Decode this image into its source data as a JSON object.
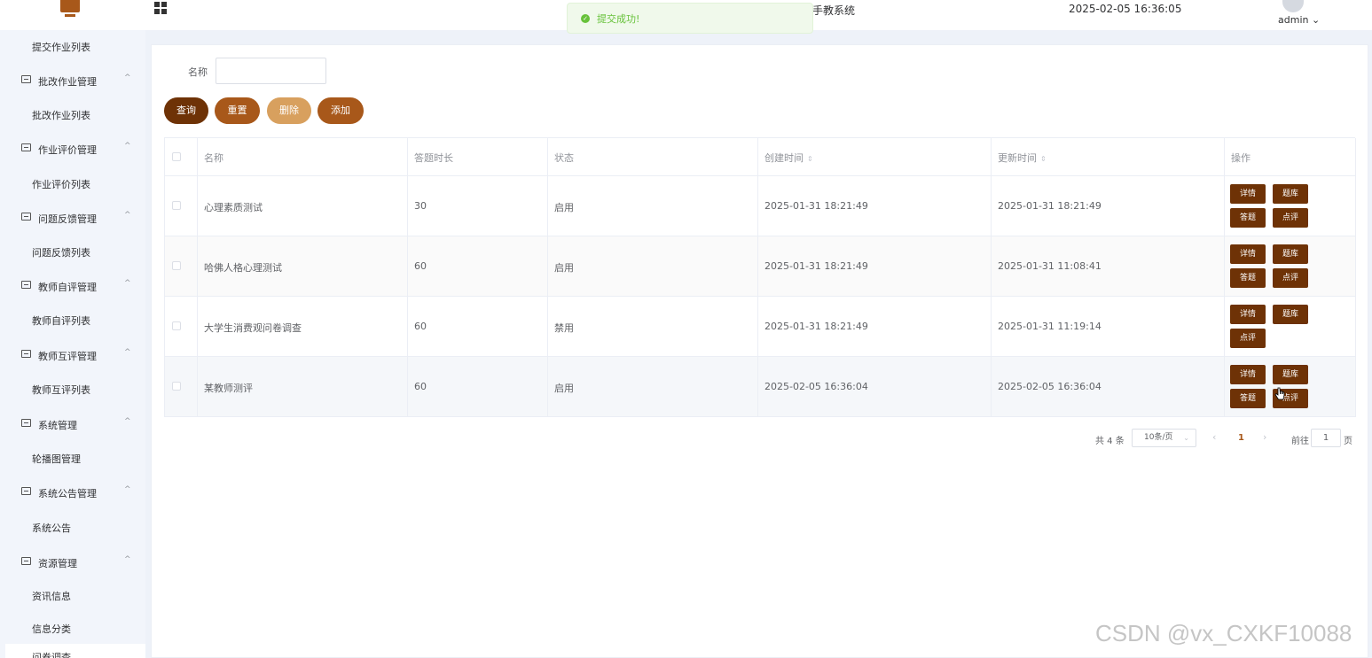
{
  "header": {
    "title": "手教系统",
    "datetime": "2025-02-05 16:36:05",
    "user": "admin",
    "user_caret": "⌄"
  },
  "toast": {
    "message": "提交成功!",
    "icon": "check-circle-icon",
    "color": "#67c23a"
  },
  "sidebar": {
    "items": [
      {
        "label": "提交作业列表",
        "type": "sub"
      },
      {
        "label": "批改作业管理",
        "type": "parent"
      },
      {
        "label": "批改作业列表",
        "type": "sub"
      },
      {
        "label": "作业评价管理",
        "type": "parent"
      },
      {
        "label": "作业评价列表",
        "type": "sub"
      },
      {
        "label": "问题反馈管理",
        "type": "parent"
      },
      {
        "label": "问题反馈列表",
        "type": "sub"
      },
      {
        "label": "教师自评管理",
        "type": "parent"
      },
      {
        "label": "教师自评列表",
        "type": "sub"
      },
      {
        "label": "教师互评管理",
        "type": "parent"
      },
      {
        "label": "教师互评列表",
        "type": "sub"
      },
      {
        "label": "系统管理",
        "type": "parent"
      },
      {
        "label": "轮播图管理",
        "type": "sub"
      },
      {
        "label": "系统公告管理",
        "type": "parent"
      },
      {
        "label": "系统公告",
        "type": "sub"
      },
      {
        "label": "资源管理",
        "type": "parent"
      },
      {
        "label": "资讯信息",
        "type": "sub"
      },
      {
        "label": "信息分类",
        "type": "sub"
      }
    ],
    "active_partial": "问卷调查",
    "caret": "^"
  },
  "search": {
    "label": "名称",
    "value": "",
    "placeholder": ""
  },
  "toolbar": {
    "query": "查询",
    "reset": "重置",
    "delete": "删除",
    "add": "添加"
  },
  "table": {
    "headers": [
      "名称",
      "答题时长",
      "状态",
      "创建时间",
      "更新时间",
      "操作"
    ],
    "sort_icon": "⇕",
    "rows": [
      {
        "name": "心理素质测试",
        "duration": "30",
        "status": "启用",
        "created": "2025-01-31 18:21:49",
        "updated": "2025-01-31 18:21:49",
        "ops": [
          "详情",
          "题库",
          "答题",
          "点评"
        ]
      },
      {
        "name": "哈佛人格心理测试",
        "duration": "60",
        "status": "启用",
        "created": "2025-01-31 18:21:49",
        "updated": "2025-01-31 11:08:41",
        "ops": [
          "详情",
          "题库",
          "答题",
          "点评"
        ]
      },
      {
        "name": "大学生消费观问卷调查",
        "duration": "60",
        "status": "禁用",
        "created": "2025-01-31 18:21:49",
        "updated": "2025-01-31 11:19:14",
        "ops": [
          "详情",
          "题库",
          "点评"
        ]
      },
      {
        "name": "某教师测评",
        "duration": "60",
        "status": "启用",
        "created": "2025-02-05 16:36:04",
        "updated": "2025-02-05 16:36:04",
        "ops": [
          "详情",
          "题库",
          "答题",
          "点评"
        ]
      }
    ]
  },
  "pagination": {
    "total": "共 4 条",
    "page_size": "10条/页",
    "current": "1",
    "goto_label": "前往",
    "goto_value": "1",
    "page_suffix": "页",
    "prev": "‹",
    "next": "›"
  },
  "watermark": "CSDN @vx_CXKF10088",
  "colors": {
    "primary": "#6e3206",
    "secondary": "#a8581a",
    "disabled": "#d8a05e",
    "sidebar_bg": "#f2f5fb"
  }
}
